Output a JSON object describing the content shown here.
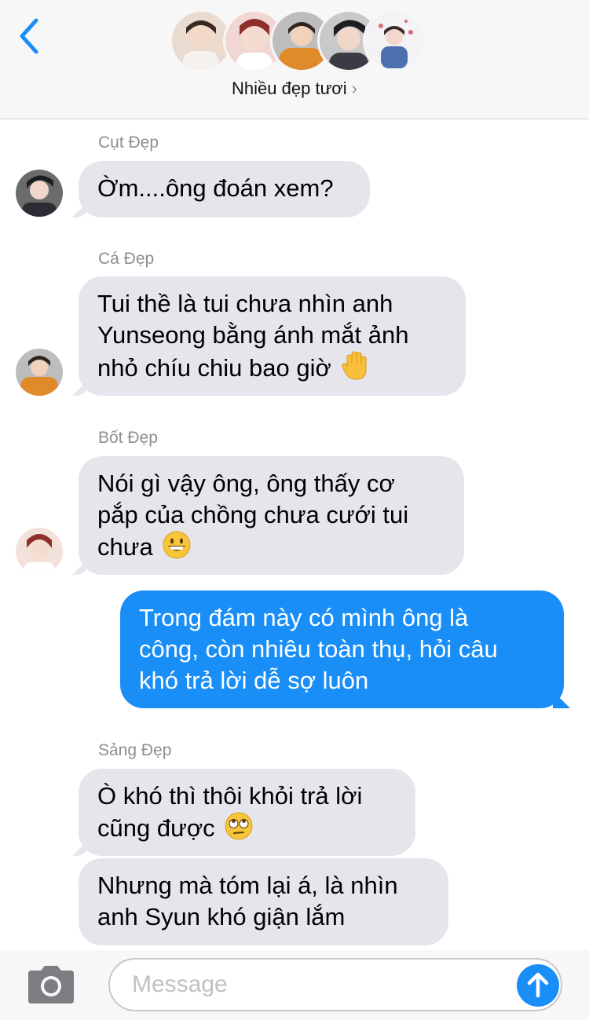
{
  "header": {
    "group_name": "Nhiều đẹp tươi",
    "chevron": "›"
  },
  "messages": [
    {
      "sender": "Cụt Đẹp",
      "lines": [
        "Ờm....ông đoán xem?"
      ]
    },
    {
      "sender": "Cá Đẹp",
      "lines": [
        "Tui thề là tui chưa nhìn anh",
        "Yunseong bằng ánh mắt ảnh",
        "nhỏ chíu chiu bao giờ"
      ],
      "emoji": "raised-hand-emoji"
    },
    {
      "sender": "Bốt Đẹp",
      "lines": [
        "Nói gì vậy ông, ông thấy cơ",
        "pắp của chồng chưa cưới tui",
        "chưa"
      ],
      "emoji": "grinning-face-emoji"
    },
    {
      "sender": "",
      "outgoing": true,
      "lines": [
        "Trong đám này có mình ông là",
        "công, còn nhiêu toàn thụ, hỏi câu",
        "khó trả lời dễ sợ luôn"
      ]
    },
    {
      "sender": "Sảng Đẹp",
      "lines": [
        "Ò khó thì thôi khỏi trả lời",
        "cũng được"
      ],
      "emoji": "eye-roll-emoji"
    },
    {
      "sender": "",
      "lines": [
        "Nhưng mà tóm lại á, là nhìn",
        "anh Syun khó giận lắm"
      ]
    }
  ],
  "input": {
    "placeholder": "Message"
  },
  "colors": {
    "accent": "#1a8ef7",
    "incoming_bubble": "#e6e5eb",
    "header_bg": "#f7f7f7"
  }
}
